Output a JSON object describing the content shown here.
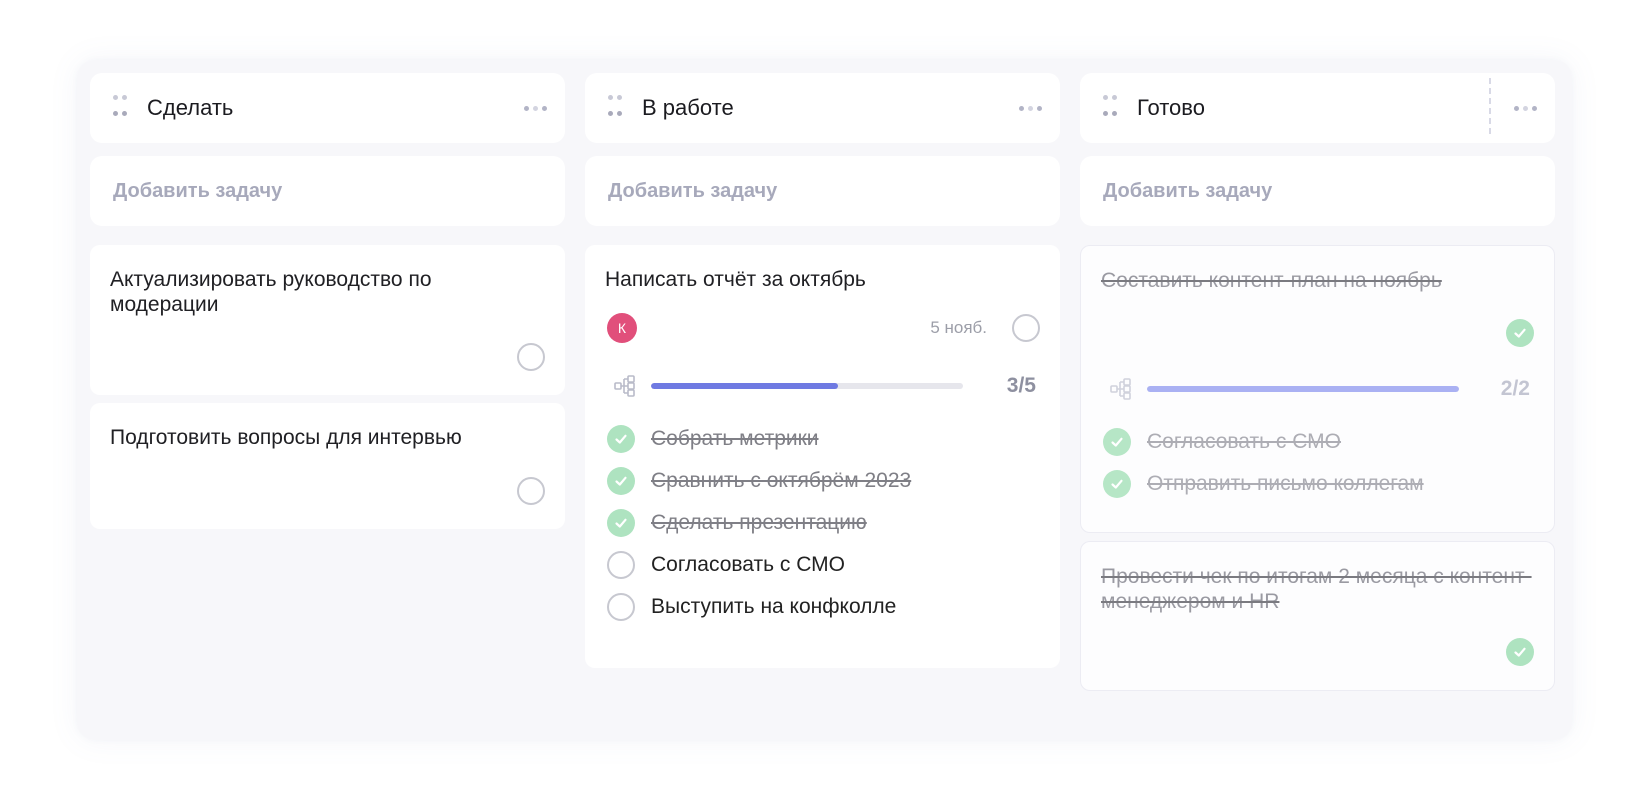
{
  "board": {
    "columns": [
      {
        "title": "Сделать",
        "add_label": "Добавить задачу",
        "cards": [
          {
            "title": "Актуализировать руководство по модерации"
          },
          {
            "title": "Подготовить вопросы для интервью"
          }
        ]
      },
      {
        "title": "В работе",
        "add_label": "Добавить задачу",
        "cards": [
          {
            "title": "Написать отчёт за октябрь",
            "avatar": "К",
            "avatar_color": "#e14f7b",
            "due": "5 нояб.",
            "progress": {
              "label": "3/5",
              "done": 3,
              "total": 5
            },
            "subtasks": [
              {
                "label": "Собрать метрики",
                "done": true
              },
              {
                "label": "Сравнить с октябрём 2023",
                "done": true
              },
              {
                "label": "Сделать презентацию",
                "done": true
              },
              {
                "label": "Согласовать с СМО",
                "done": false
              },
              {
                "label": "Выступить на конфколле",
                "done": false
              }
            ]
          }
        ]
      },
      {
        "title": "Готово",
        "add_label": "Добавить задачу",
        "cards": [
          {
            "title": "Составить контент-план на ноябрь",
            "progress": {
              "label": "2/2",
              "done": 2,
              "total": 2
            },
            "subtasks": [
              {
                "label": "Согласовать с СМО",
                "done": true
              },
              {
                "label": "Отправить письмо коллегам",
                "done": true
              }
            ]
          },
          {
            "title": "Провести чек по итогам 2 месяца с контент-менеджером и HR"
          }
        ]
      }
    ]
  },
  "icons": {
    "drag": "drag-handle-icon",
    "more": "more-horizontal-icon",
    "subtasks": "subtasks-tree-icon",
    "check": "check-icon"
  },
  "colors": {
    "accent": "#6f7ae2",
    "check": "#aee3c0",
    "avatar": "#e14f7b"
  }
}
